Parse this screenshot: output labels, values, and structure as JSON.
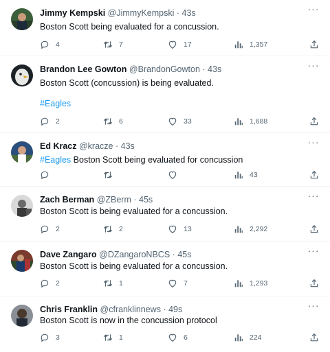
{
  "tweets": [
    {
      "name": "Jimmy Kempski",
      "handle": "@JimmyKempski",
      "separator": "·",
      "time": "43s",
      "hashtag": "",
      "text": "Boston Scott being evaluated for a concussion.",
      "replies": "4",
      "retweets": "7",
      "likes": "17",
      "views": "1,357",
      "avatar_color": "#3b5f3a",
      "icons": {
        "reply": "reply-icon",
        "retweet": "retweet-icon",
        "like": "heart-icon",
        "views": "views-icon",
        "share": "share-icon",
        "more": "more-icon"
      }
    },
    {
      "name": "Brandon Lee Gowton",
      "handle": "@BrandonGowton",
      "separator": "·",
      "time": "43s",
      "text": "Boston Scott (concussion) is being evaluated.",
      "hashtag": "#Eagles",
      "replies": "2",
      "retweets": "6",
      "likes": "33",
      "views": "1,688",
      "avatar_color": "#1d2226"
    },
    {
      "name": "Ed Kracz",
      "handle": "@kracze",
      "separator": "·",
      "time": "43s",
      "hashtag": "#Eagles",
      "text": " Boston Scott being evaluated for concussion",
      "replies": "",
      "retweets": "",
      "likes": "",
      "views": "43",
      "avatar_color": "#2b4f7c"
    },
    {
      "name": "Zach Berman",
      "handle": "@ZBerm",
      "separator": "·",
      "time": "45s",
      "hashtag": "",
      "text": "Boston Scott is being evaluated for a concussion.",
      "replies": "2",
      "retweets": "2",
      "likes": "13",
      "views": "2,292",
      "avatar_color": "#6b6b6b"
    },
    {
      "name": "Dave Zangaro",
      "handle": "@DZangaroNBCS",
      "separator": "·",
      "time": "45s",
      "hashtag": "",
      "text": "Boston Scott is being evaluated for a concussion.",
      "replies": "2",
      "retweets": "1",
      "likes": "7",
      "views": "1,293",
      "avatar_color": "#7a3b2e"
    },
    {
      "name": "Chris Franklin",
      "handle": "@cfranklinnews",
      "separator": "·",
      "time": "49s",
      "hashtag": "",
      "text": "Boston Scott is now in the concussion protocol",
      "replies": "3",
      "retweets": "1",
      "likes": "6",
      "views": "224",
      "avatar_color": "#4a3a2e"
    }
  ],
  "colors": {
    "text": "#0f1419",
    "muted": "#536471",
    "link": "#1d9bf0",
    "divider": "#eff3f4"
  }
}
